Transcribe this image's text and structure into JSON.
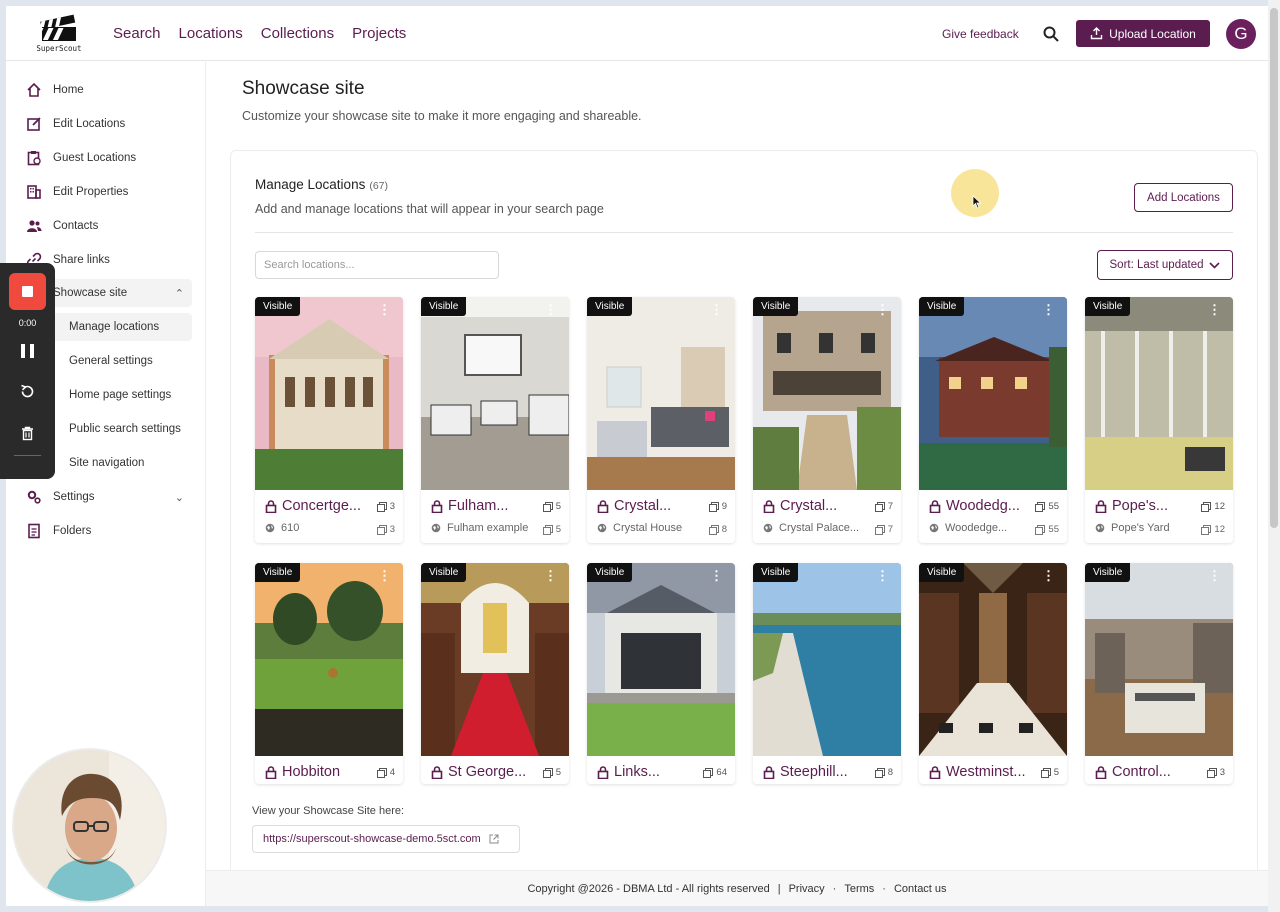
{
  "header": {
    "logo_text": "SuperScout",
    "nav": [
      "Search",
      "Locations",
      "Collections",
      "Projects"
    ],
    "feedback": "Give feedback",
    "upload": "Upload Location",
    "avatar_initial": "G",
    "brand_color": "#5b1d4f"
  },
  "sidebar": {
    "items": [
      {
        "label": "Home",
        "icon": "home-icon"
      },
      {
        "label": "Edit Locations",
        "icon": "edit-icon"
      },
      {
        "label": "Guest Locations",
        "icon": "clipboard-icon"
      },
      {
        "label": "Edit Properties",
        "icon": "building-icon"
      },
      {
        "label": "Contacts",
        "icon": "users-icon"
      },
      {
        "label": "Share links",
        "icon": "link-icon"
      },
      {
        "label": "Showcase site",
        "icon": "showcase-icon"
      },
      {
        "label": "Settings",
        "icon": "gear-icon"
      },
      {
        "label": "Folders",
        "icon": "folder-icon"
      }
    ],
    "sub_items": [
      "Manage locations",
      "General settings",
      "Home page settings",
      "Public search settings",
      "Site navigation"
    ]
  },
  "recorder": {
    "time": "0:00"
  },
  "main": {
    "title": "Showcase site",
    "subtitle": "Customize your showcase site to make it more engaging and shareable.",
    "manage_title": "Manage Locations",
    "manage_count": "(67)",
    "manage_sub": "Add and manage locations that will appear in your search page",
    "add_button": "Add Locations",
    "search_placeholder": "Search locations...",
    "sort": "Sort: Last updated",
    "showcase_label": "View your Showcase Site here:",
    "showcase_url": "https://superscout-showcase-demo.5sct.com"
  },
  "cards": [
    {
      "badge": "Visible",
      "name": "Concertge...",
      "count": "3",
      "sub": "610",
      "sub_count": "3"
    },
    {
      "badge": "Visible",
      "name": "Fulham...",
      "count": "5",
      "sub": "Fulham example",
      "sub_count": "5"
    },
    {
      "badge": "Visible",
      "name": "Crystal...",
      "count": "9",
      "sub": "Crystal House",
      "sub_count": "8"
    },
    {
      "badge": "Visible",
      "name": "Crystal...",
      "count": "7",
      "sub": "Crystal Palace...",
      "sub_count": "7"
    },
    {
      "badge": "Visible",
      "name": "Woodedg...",
      "count": "55",
      "sub": "Woodedge...",
      "sub_count": "55"
    },
    {
      "badge": "Visible",
      "name": "Pope's...",
      "count": "12",
      "sub": "Pope's Yard",
      "sub_count": "12"
    },
    {
      "badge": "Visible",
      "name": "Hobbiton",
      "count": "4"
    },
    {
      "badge": "Visible",
      "name": "St George...",
      "count": "5"
    },
    {
      "badge": "Visible",
      "name": "Links...",
      "count": "64"
    },
    {
      "badge": "Visible",
      "name": "Steephill...",
      "count": "8"
    },
    {
      "badge": "Visible",
      "name": "Westminst...",
      "count": "5"
    },
    {
      "badge": "Visible",
      "name": "Control...",
      "count": "3"
    }
  ],
  "footer": {
    "copyright": "Copyright @2026 - DBMA Ltd - All rights reserved",
    "sep": "|",
    "privacy": "Privacy",
    "terms": "Terms",
    "contact": "Contact us"
  }
}
